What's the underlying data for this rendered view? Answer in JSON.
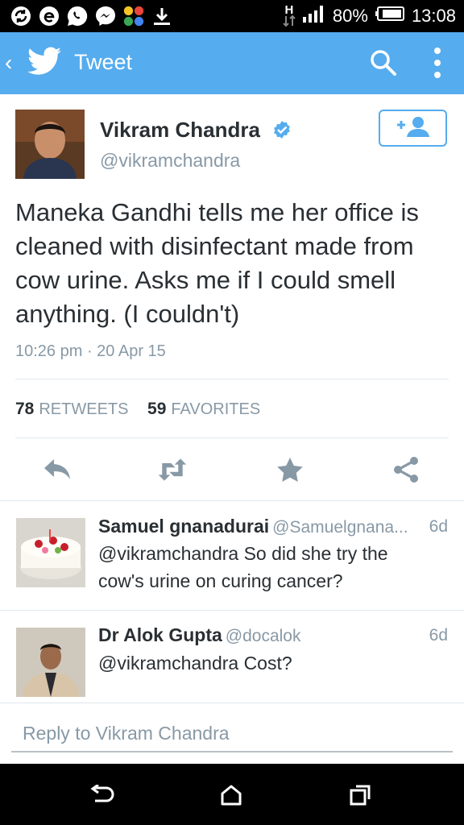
{
  "status_bar": {
    "network": "H",
    "battery": "80%",
    "time": "13:08"
  },
  "app_bar": {
    "back_glyph": "‹",
    "title": "Tweet"
  },
  "tweet": {
    "author_name": "Vikram Chandra",
    "author_handle": "@vikramchandra",
    "text": "Maneka Gandhi tells me her office is cleaned with disinfectant made from cow urine. Asks me if I could smell anything. (I couldn't)",
    "timestamp": "10:26 pm · 20 Apr 15",
    "retweets_count": "78",
    "retweets_label": "RETWEETS",
    "favorites_count": "59",
    "favorites_label": "FAVORITES",
    "follow_icon": "follow-icon"
  },
  "replies": [
    {
      "name": "Samuel gnanadurai",
      "handle": "@Samuelgnana...",
      "time": "6d",
      "text": "@vikramchandra So did she try the cow's urine on curing cancer?"
    },
    {
      "name": "Dr Alok Gupta",
      "handle": "@docalok",
      "time": "6d",
      "text": "@vikramchandra Cost?"
    }
  ],
  "reply_box": {
    "placeholder": "Reply to Vikram Chandra"
  },
  "colors": {
    "brand": "#55acee",
    "text": "#292f33",
    "muted": "#8899a6",
    "action_icon": "#8899a6"
  }
}
